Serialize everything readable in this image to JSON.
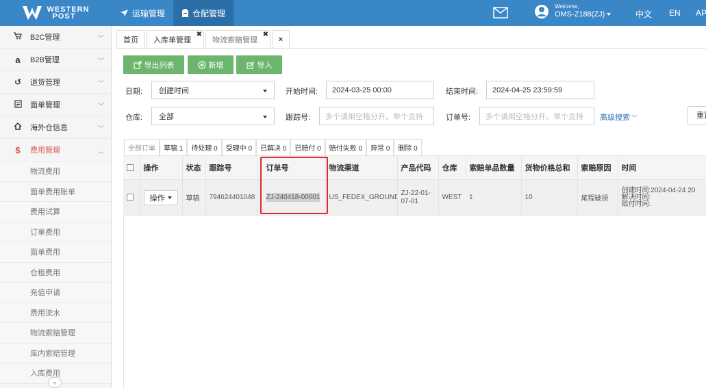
{
  "app": {
    "logo_line1": "WESTERN",
    "logo_line2": "POST"
  },
  "top_nav": [
    {
      "label": "运输管理",
      "icon": "plane-icon"
    },
    {
      "label": "仓配管理",
      "icon": "clipboard-icon"
    }
  ],
  "user": {
    "welcome": "Welcome,",
    "name": "OMS-Z188(ZJ)"
  },
  "lang": {
    "zh": "中文",
    "en": "EN",
    "ap": "AP"
  },
  "sidebar": {
    "items": [
      {
        "label": "B2C管理",
        "icon": "cart-icon",
        "glyph": "🛒"
      },
      {
        "label": "B2B管理",
        "icon": "amazon-icon",
        "glyph": "a"
      },
      {
        "label": "退货管理",
        "icon": "undo-icon",
        "glyph": "↺"
      },
      {
        "label": "面单管理",
        "icon": "document-icon",
        "glyph": "▤"
      },
      {
        "label": "海外仓信息",
        "icon": "home-icon",
        "glyph": "⌂"
      },
      {
        "label": "费用管理",
        "icon": "dollar-icon",
        "glyph": "$"
      }
    ],
    "sub_items": [
      "物流费用",
      "面单费用账单",
      "费用试算",
      "订单费用",
      "面单费用",
      "仓租费用",
      "充值申请",
      "费用流水",
      "物流索赔管理",
      "库内索赔管理",
      "入库费用"
    ],
    "collapse": "«"
  },
  "tabs": [
    {
      "label": "首页"
    },
    {
      "label": "入库单管理"
    },
    {
      "label": "物流索赔管理"
    }
  ],
  "tab_close_all": "×",
  "toolbar": {
    "export": "导出列表",
    "add": "新增",
    "import": "导入"
  },
  "filters": {
    "date_label": "日期:",
    "date_value": "创建时间",
    "start_label": "开始时间:",
    "start_value": "2024-03-25 00:00",
    "end_label": "结束时间:",
    "end_value": "2024-04-25 23:59:59",
    "warehouse_label": "仓库:",
    "warehouse_value": "全部",
    "tracking_label": "跟踪号:",
    "tracking_placeholder": "多个请用空格分开。单个支持",
    "order_label": "订单号:",
    "order_placeholder": "多个请用空格分开。单个支持",
    "advanced": "高级搜索",
    "reset": "重置"
  },
  "status_tabs": [
    "全部订单",
    "草稿 1",
    "待处理 0",
    "受理中 0",
    "已解决 0",
    "已赔付 0",
    "赔付失败 0",
    "异常 0",
    "删除 0"
  ],
  "table": {
    "headers": [
      "",
      "操作",
      "状态",
      "跟踪号",
      "订单号",
      "物流渠道",
      "产品代码",
      "仓库",
      "索赔单品数量",
      "货物价格总和",
      "索赔原因",
      "时间"
    ],
    "row": {
      "op": "操作",
      "status": "草稿",
      "tracking": "794624401048",
      "order": "ZJ-240418-00001",
      "channel": "US_FEDEX_GROUND",
      "product": "ZJ-22-01-07-01",
      "warehouse": "WEST",
      "qty": "1",
      "price": "10",
      "reason": "尾程破损",
      "created": "创建时间:2024-04-24 20",
      "resolved": "解决时间:",
      "paid": "赔付时间:"
    }
  },
  "colors": {
    "topbar": "#3a87c7",
    "button_green": "#6cb56c",
    "highlight_red": "#e5262b"
  }
}
